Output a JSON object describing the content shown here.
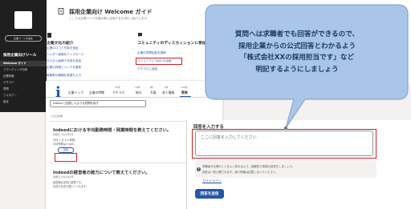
{
  "colors": {
    "accent_blue": "#2557a7",
    "highlight_red": "#d21f2a",
    "sidebar_bg": "#1f1f1f",
    "callout_fill": "#a9c6e8",
    "callout_stroke": "#8aa7cc",
    "callout_text": "#1d3a63"
  },
  "sidebar": {
    "button_label": "企業ページを編集",
    "section_title": "採用企業向けツール",
    "items": [
      {
        "label": "Welcome ガイド",
        "active": true
      },
      {
        "label": "ブランディング分析"
      },
      {
        "label": "企業評価"
      },
      {
        "label": "クチコミ"
      },
      {
        "label": "質問"
      },
      {
        "label": "フォロワー"
      },
      {
        "label": "設定"
      }
    ]
  },
  "guide": {
    "title": "採用企業向け Welcome ガイド",
    "subtitle": "ここでは企業ページを最大限に活用する方法をご紹介します。",
    "left_section": {
      "title": "企業文化の紹介",
      "links": [
        "企業のロゴと写真を追加",
        "ヘッダー画像をアップロード",
        "カスタム画像で写真を追加",
        "企業の詳細とリンクを更新",
        "概要等の情報を英語も入力"
      ]
    },
    "right_section": {
      "title": "コミュニティのディスカッションに参加",
      "links": [
        "企業の質問回答を更新",
        "コミュニティ Q&A の活用",
        "クチコミに返信"
      ]
    }
  },
  "qa": {
    "nav_icon": "i",
    "tabs": [
      {
        "label": "企業トップ",
        "count": ""
      },
      {
        "label": "企業の特徴",
        "count": ""
      },
      {
        "label": "クチコミ",
        "count": "45件"
      },
      {
        "label": "給与",
        "count": "16件"
      },
      {
        "label": "写真",
        "count": "4件"
      },
      {
        "label": "求人情報",
        "count": "8件"
      },
      {
        "label": "質問",
        "count": "100件"
      }
    ],
    "search_placeholder": "Indeed と回答したような質問を探す",
    "list_label": "人気の質問",
    "questions": [
      {
        "title": "Indeedにおける平均勤務時間・残業時間を教えてください。",
        "meta": "質問日 2021年4月",
        "lines": [
          "平均 1 日 9.5 時間。",
          "平均残業は少なめ。"
        ],
        "answer_button": "回答"
      },
      {
        "title": "Indeedの経営者の能力について教えてください。",
        "meta": "質問日 2021年3月",
        "lines": [
          "経営陣は非常に優秀です。",
          "社員の意見も聞いてくれます。"
        ],
        "answer_button": "回答"
      }
    ]
  },
  "answer_panel": {
    "label": "回答を入力する",
    "placeholder": "ここに回答を入力してください",
    "notes": [
      "求職者が企業のことをよく知れるよう、客観的で事実な回答をしましょう。",
      "回答は一般公開されます。個人情報は記載しないでください。"
    ],
    "guideline_link": "ガイドライン",
    "submit_label": "回答を送信"
  },
  "callout": {
    "lines": [
      "質問へは求職者でも回答ができるので、",
      "採用企業からの公式回答とわかるよう",
      "「株式会社XXの採用担当です」など",
      "明記するようにしましょう"
    ]
  }
}
